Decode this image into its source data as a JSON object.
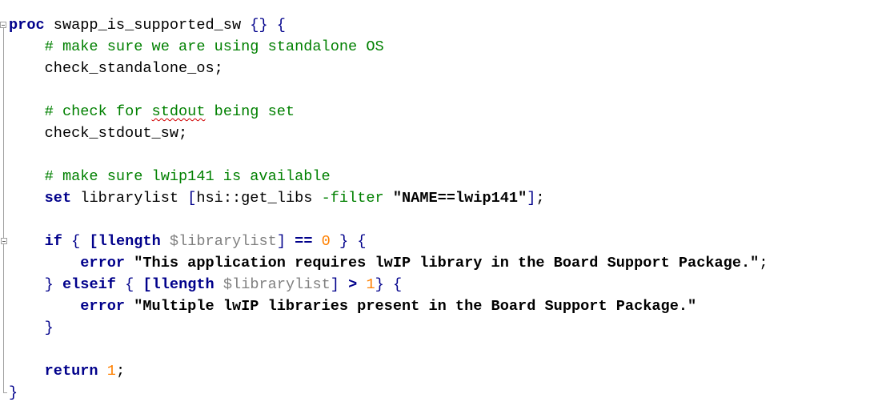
{
  "editor": {
    "lines": [
      {
        "tokens": [
          [
            "kw",
            "proc"
          ],
          [
            "plain",
            " swapp_is_supported_sw "
          ],
          [
            "brk",
            "{}"
          ],
          [
            "plain",
            " "
          ],
          [
            "brk",
            "{"
          ]
        ]
      },
      {
        "tokens": [
          [
            "plain",
            "    "
          ],
          [
            "cm",
            "# make sure we are using standalone OS"
          ]
        ]
      },
      {
        "tokens": [
          [
            "plain",
            "    check_standalone_os;"
          ]
        ]
      },
      {
        "tokens": []
      },
      {
        "tokens": [
          [
            "plain",
            "    "
          ],
          [
            "cm",
            "# check for "
          ],
          [
            "cm sq",
            "stdout"
          ],
          [
            "cm",
            " being set"
          ]
        ]
      },
      {
        "tokens": [
          [
            "plain",
            "    check_stdout_sw;"
          ]
        ]
      },
      {
        "tokens": []
      },
      {
        "tokens": [
          [
            "plain",
            "    "
          ],
          [
            "cm",
            "# make sure lwip141 is available"
          ]
        ]
      },
      {
        "tokens": [
          [
            "plain",
            "    "
          ],
          [
            "kw",
            "set"
          ],
          [
            "plain",
            " librarylist "
          ],
          [
            "brk",
            "["
          ],
          [
            "plain",
            "hsi::get_libs "
          ],
          [
            "cm",
            "-filter"
          ],
          [
            "plain",
            " "
          ],
          [
            "str",
            "\"NAME==lwip141\""
          ],
          [
            "brk",
            "]"
          ],
          [
            "plain",
            ";"
          ]
        ]
      },
      {
        "tokens": []
      },
      {
        "tokens": [
          [
            "plain",
            "    "
          ],
          [
            "kw",
            "if"
          ],
          [
            "plain",
            " "
          ],
          [
            "brk",
            "{"
          ],
          [
            "plain",
            " "
          ],
          [
            "kw",
            "[llength"
          ],
          [
            "plain",
            " "
          ],
          [
            "var",
            "$librarylist"
          ],
          [
            "brk",
            "]"
          ],
          [
            "plain",
            " "
          ],
          [
            "op",
            "=="
          ],
          [
            "plain",
            " "
          ],
          [
            "num",
            "0"
          ],
          [
            "plain",
            " "
          ],
          [
            "brk",
            "}"
          ],
          [
            "plain",
            " "
          ],
          [
            "brk",
            "{"
          ]
        ]
      },
      {
        "tokens": [
          [
            "plain",
            "        "
          ],
          [
            "kw",
            "error"
          ],
          [
            "plain",
            " "
          ],
          [
            "str",
            "\"This application requires lwIP library in the Board Support Package.\""
          ],
          [
            "plain",
            ";"
          ]
        ]
      },
      {
        "tokens": [
          [
            "plain",
            "    "
          ],
          [
            "brk",
            "}"
          ],
          [
            "plain",
            " "
          ],
          [
            "kw",
            "elseif"
          ],
          [
            "plain",
            " "
          ],
          [
            "brk",
            "{"
          ],
          [
            "plain",
            " "
          ],
          [
            "kw",
            "[llength"
          ],
          [
            "plain",
            " "
          ],
          [
            "var",
            "$librarylist"
          ],
          [
            "brk",
            "]"
          ],
          [
            "plain",
            " "
          ],
          [
            "op",
            ">"
          ],
          [
            "plain",
            " "
          ],
          [
            "num",
            "1"
          ],
          [
            "brk",
            "}"
          ],
          [
            "plain",
            " "
          ],
          [
            "brk",
            "{"
          ]
        ]
      },
      {
        "tokens": [
          [
            "plain",
            "        "
          ],
          [
            "kw",
            "error"
          ],
          [
            "plain",
            " "
          ],
          [
            "str",
            "\"Multiple lwIP libraries present in the Board Support Package.\""
          ]
        ]
      },
      {
        "tokens": [
          [
            "plain",
            "    "
          ],
          [
            "brk",
            "}"
          ]
        ]
      },
      {
        "tokens": []
      },
      {
        "tokens": [
          [
            "plain",
            "    "
          ],
          [
            "kw",
            "return"
          ],
          [
            "plain",
            " "
          ],
          [
            "num",
            "1"
          ],
          [
            "plain",
            ";"
          ]
        ]
      },
      {
        "tokens": [
          [
            "brk",
            "}"
          ]
        ]
      }
    ]
  },
  "colors": {
    "keyword": "#00008b",
    "comment": "#008000",
    "variable": "#808080",
    "number": "#ff8000",
    "background": "#ffffff"
  }
}
